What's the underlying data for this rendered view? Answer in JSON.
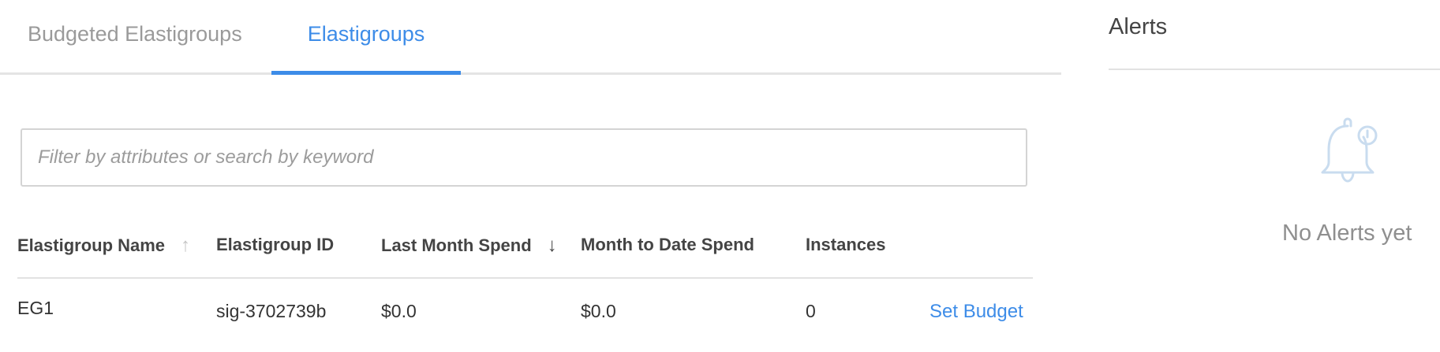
{
  "tabs": {
    "budgeted_label": "Budgeted Elastigroups",
    "elastigroups_label": "Elastigroups"
  },
  "search": {
    "placeholder": "Filter by attributes or search by keyword",
    "value": ""
  },
  "table": {
    "headers": {
      "name": "Elastigroup Name",
      "id": "Elastigroup ID",
      "last_month": "Last Month Spend",
      "month_to_date": "Month to Date Spend",
      "instances": "Instances"
    },
    "sort": {
      "name_icon": "arrow-up-icon",
      "last_month_icon": "arrow-down-icon"
    },
    "rows": [
      {
        "name": "EG1",
        "id": "sig-3702739b",
        "last_month": "$0.0",
        "month_to_date": "$0.0",
        "instances": "0",
        "action": "Set Budget"
      }
    ]
  },
  "alerts": {
    "title": "Alerts",
    "empty_text": "No Alerts yet",
    "icon": "bell-icon"
  },
  "colors": {
    "accent": "#3d8ce8",
    "muted": "#9a9a9a",
    "divider": "#e2e2e2"
  }
}
